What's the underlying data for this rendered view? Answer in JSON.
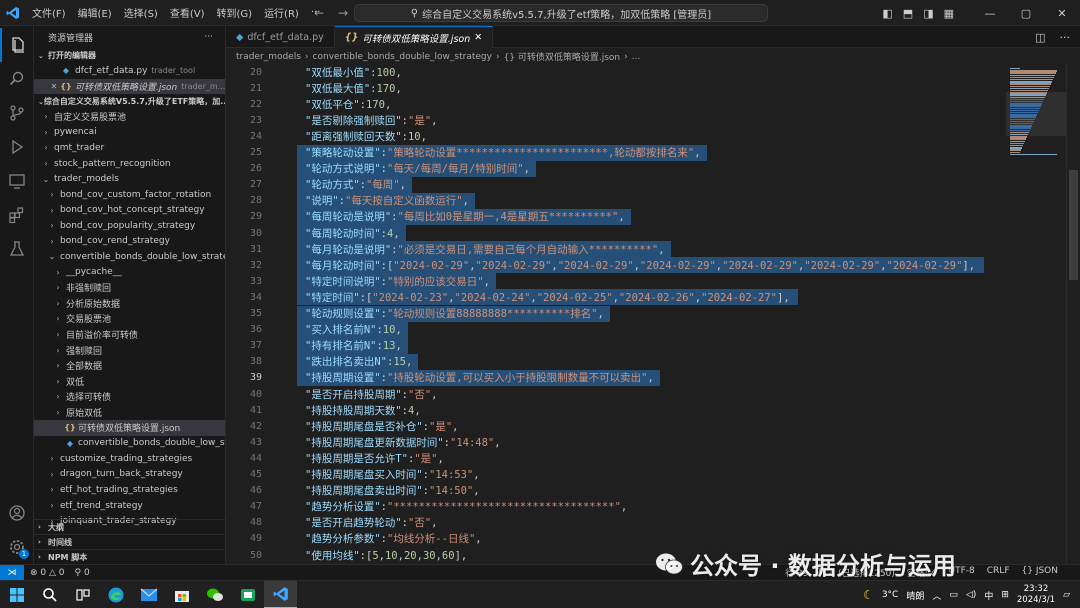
{
  "window": {
    "title": "综合自定义交易系统v5.5.7,升级了etf策略，加双低策略 [管理员]",
    "menu": [
      "文件(F)",
      "编辑(E)",
      "选择(S)",
      "查看(V)",
      "转到(G)",
      "运行(R)",
      "···"
    ]
  },
  "sidebar": {
    "header": "资源管理器",
    "more": "···",
    "open_editors_title": "打开的编辑器",
    "open_editors": [
      {
        "name": "dfcf_etf_data.py",
        "desc": "trader_tool",
        "icon": "python-file-icon"
      },
      {
        "name": "可转债双低策略设置.json",
        "desc": "trader_m...",
        "icon": "json-file-icon",
        "close": "✕"
      }
    ],
    "workspace_title": "综合自定义交易系统V5.5.7,升级了ETF策略，加...",
    "tree": [
      {
        "label": "自定义交易股票池",
        "depth": 1,
        "chev": "›"
      },
      {
        "label": "pywencai",
        "depth": 1,
        "chev": "›"
      },
      {
        "label": "qmt_trader",
        "depth": 1,
        "chev": "›"
      },
      {
        "label": "stock_pattern_recognition",
        "depth": 1,
        "chev": "›"
      },
      {
        "label": "trader_models",
        "depth": 1,
        "chev": "⌄"
      },
      {
        "label": "bond_cov_custom_factor_rotation",
        "depth": 2,
        "chev": "›"
      },
      {
        "label": "bond_cov_hot_concept_strategy",
        "depth": 2,
        "chev": "›"
      },
      {
        "label": "bond_cov_popularity_strategy",
        "depth": 2,
        "chev": "›"
      },
      {
        "label": "bond_cov_rend_strategy",
        "depth": 2,
        "chev": "›"
      },
      {
        "label": "convertible_bonds_double_low_strategy",
        "depth": 2,
        "chev": "⌄"
      },
      {
        "label": "__pycache__",
        "depth": 3,
        "chev": "›"
      },
      {
        "label": "非强制赎回",
        "depth": 3,
        "chev": "›"
      },
      {
        "label": "分析原始数据",
        "depth": 3,
        "chev": "›"
      },
      {
        "label": "交易股票池",
        "depth": 3,
        "chev": "›"
      },
      {
        "label": "目前溢价率可转债",
        "depth": 3,
        "chev": "›"
      },
      {
        "label": "强制赎回",
        "depth": 3,
        "chev": "›"
      },
      {
        "label": "全部数据",
        "depth": 3,
        "chev": "›"
      },
      {
        "label": "双低",
        "depth": 3,
        "chev": "›"
      },
      {
        "label": "选择可转债",
        "depth": 3,
        "chev": "›"
      },
      {
        "label": "原始双低",
        "depth": 3,
        "chev": "›"
      },
      {
        "label": "可转债双低策略设置.json",
        "depth": 3,
        "chev": "",
        "icon": "json",
        "selected": true
      },
      {
        "label": "convertible_bonds_double_low_strat...",
        "depth": 3,
        "chev": "",
        "icon": "python"
      },
      {
        "label": "customize_trading_strategies",
        "depth": 2,
        "chev": "›"
      },
      {
        "label": "dragon_turn_back_strategy",
        "depth": 2,
        "chev": "›"
      },
      {
        "label": "etf_hot_trading_strategies",
        "depth": 2,
        "chev": "›"
      },
      {
        "label": "etf_trend_strategy",
        "depth": 2,
        "chev": "›"
      },
      {
        "label": "joinquant_trader_strategy",
        "depth": 2,
        "chev": "›"
      }
    ],
    "bottom_sections": [
      "大纲",
      "时间线",
      "NPM 脚本"
    ]
  },
  "activity": {
    "settings_badge": "1"
  },
  "editor": {
    "tabs": [
      {
        "label": "dfcf_etf_data.py",
        "icon": "python-file-icon",
        "active": false
      },
      {
        "label": "可转债双低策略设置.json",
        "icon": "json-file-icon",
        "active": true
      }
    ],
    "breadcrumb": [
      "trader_models",
      "convertible_bonds_double_low_strategy",
      "{} 可转债双低策略设置.json",
      "..."
    ],
    "current_line": 39,
    "lines": [
      {
        "n": 20,
        "key": "双低最小值",
        "val": "100",
        "type": "num"
      },
      {
        "n": 21,
        "key": "双低最大值",
        "val": "170",
        "type": "num"
      },
      {
        "n": 22,
        "key": "双低平仓",
        "val": "170",
        "type": "num"
      },
      {
        "n": 23,
        "key": "是否剔除强制赎回",
        "val": "是",
        "type": "str"
      },
      {
        "n": 24,
        "key": "距离强制赎回天数",
        "val": "10",
        "type": "num"
      },
      {
        "n": 25,
        "key": "策略轮动设置",
        "val": "策略轮动设置************************,轮动都按排名来",
        "type": "str",
        "sel": true
      },
      {
        "n": 26,
        "key": "轮动方式说明",
        "val": "每天/每周/每月/特别时间",
        "type": "str",
        "sel": true
      },
      {
        "n": 27,
        "key": "轮动方式",
        "val": "每周",
        "type": "str",
        "sel": true
      },
      {
        "n": 28,
        "key": "说明",
        "val": "每天按自定义函数运行",
        "type": "str",
        "sel": true
      },
      {
        "n": 29,
        "key": "每周轮动是说明",
        "val": "每周比如0是星期一,4是星期五**********",
        "type": "str",
        "sel": true
      },
      {
        "n": 30,
        "key": "每周轮动时间",
        "val": "4",
        "type": "num",
        "sel": true
      },
      {
        "n": 31,
        "key": "每月轮动是说明",
        "val": "必须是交易日,需要自己每个月自动输入**********",
        "type": "str",
        "sel": true
      },
      {
        "n": 32,
        "key": "每月轮动时间",
        "arr": [
          "2024-02-29",
          "2024-02-29",
          "2024-02-29",
          "2024-02-29",
          "2024-02-29",
          "2024-02-29",
          "2024-02-29"
        ],
        "type": "arr",
        "sel": true
      },
      {
        "n": 33,
        "key": "特定时间说明",
        "val": "特别的应该交易日",
        "type": "str",
        "sel": true
      },
      {
        "n": 34,
        "key": "特定时间",
        "arr": [
          "2024-02-23",
          "2024-02-24",
          "2024-02-25",
          "2024-02-26",
          "2024-02-27"
        ],
        "type": "arr",
        "sel": true
      },
      {
        "n": 35,
        "key": "轮动规则设置",
        "val": "轮动规则设置88888888**********排名",
        "type": "str",
        "sel": true
      },
      {
        "n": 36,
        "key": "买入排名前N",
        "val": "10",
        "type": "num",
        "sel": true
      },
      {
        "n": 37,
        "key": "持有排名前N",
        "val": "13",
        "type": "num",
        "sel": true
      },
      {
        "n": 38,
        "key": "跌出排名卖出N",
        "val": "15",
        "type": "num",
        "sel": true
      },
      {
        "n": 39,
        "key": "持股周期设置",
        "val": "持股轮动设置,可以买入小于持股限制数量不可以卖出",
        "type": "str",
        "sel": true
      },
      {
        "n": 40,
        "key": "是否开启持股周期",
        "val": "否",
        "type": "str"
      },
      {
        "n": 41,
        "key": "持股持股周期天数",
        "val": "4",
        "type": "num"
      },
      {
        "n": 42,
        "key": "持股周期尾盘是否补仓",
        "val": "是",
        "type": "str"
      },
      {
        "n": 43,
        "key": "持股周期尾盘更新数据时间",
        "val": "14:48",
        "type": "str"
      },
      {
        "n": 44,
        "key": "持股周期是否允许T",
        "val": "是",
        "type": "str"
      },
      {
        "n": 45,
        "key": "持股周期尾盘买入时间",
        "val": "14:53",
        "type": "str"
      },
      {
        "n": 46,
        "key": "持股周期尾盘卖出时间",
        "val": "14:50",
        "type": "str"
      },
      {
        "n": 47,
        "key": "趋势分析设置",
        "val": "***********************************",
        "type": "str"
      },
      {
        "n": 48,
        "key": "是否开启趋势轮动",
        "val": "否",
        "type": "str"
      },
      {
        "n": 49,
        "key": "趋势分析参数",
        "val": "均线分析--日线",
        "type": "str"
      },
      {
        "n": 50,
        "key": "使用均线",
        "nums": [
          5,
          10,
          20,
          30,
          60
        ],
        "type": "numarr"
      }
    ]
  },
  "statusbar": {
    "errors": "⊗ 0 △ 0",
    "ports": "⚲ 0",
    "right": [
      "行 39，列 4 (已选择1250)",
      "空格: 4",
      "UTF-8",
      "CRLF",
      "{} JSON"
    ]
  },
  "watermark": "公众号 · 数据分析与运用",
  "taskbar": {
    "weather_temp": "3°C",
    "weather_desc": "晴朗",
    "ime": "中",
    "time": "23:32",
    "date": "2024/3/1"
  },
  "colors": {
    "accent": "#0078d4",
    "selection": "#264f78",
    "json_key": "#9cdcfe",
    "json_string": "#ce9178",
    "json_number": "#b5cea8"
  }
}
